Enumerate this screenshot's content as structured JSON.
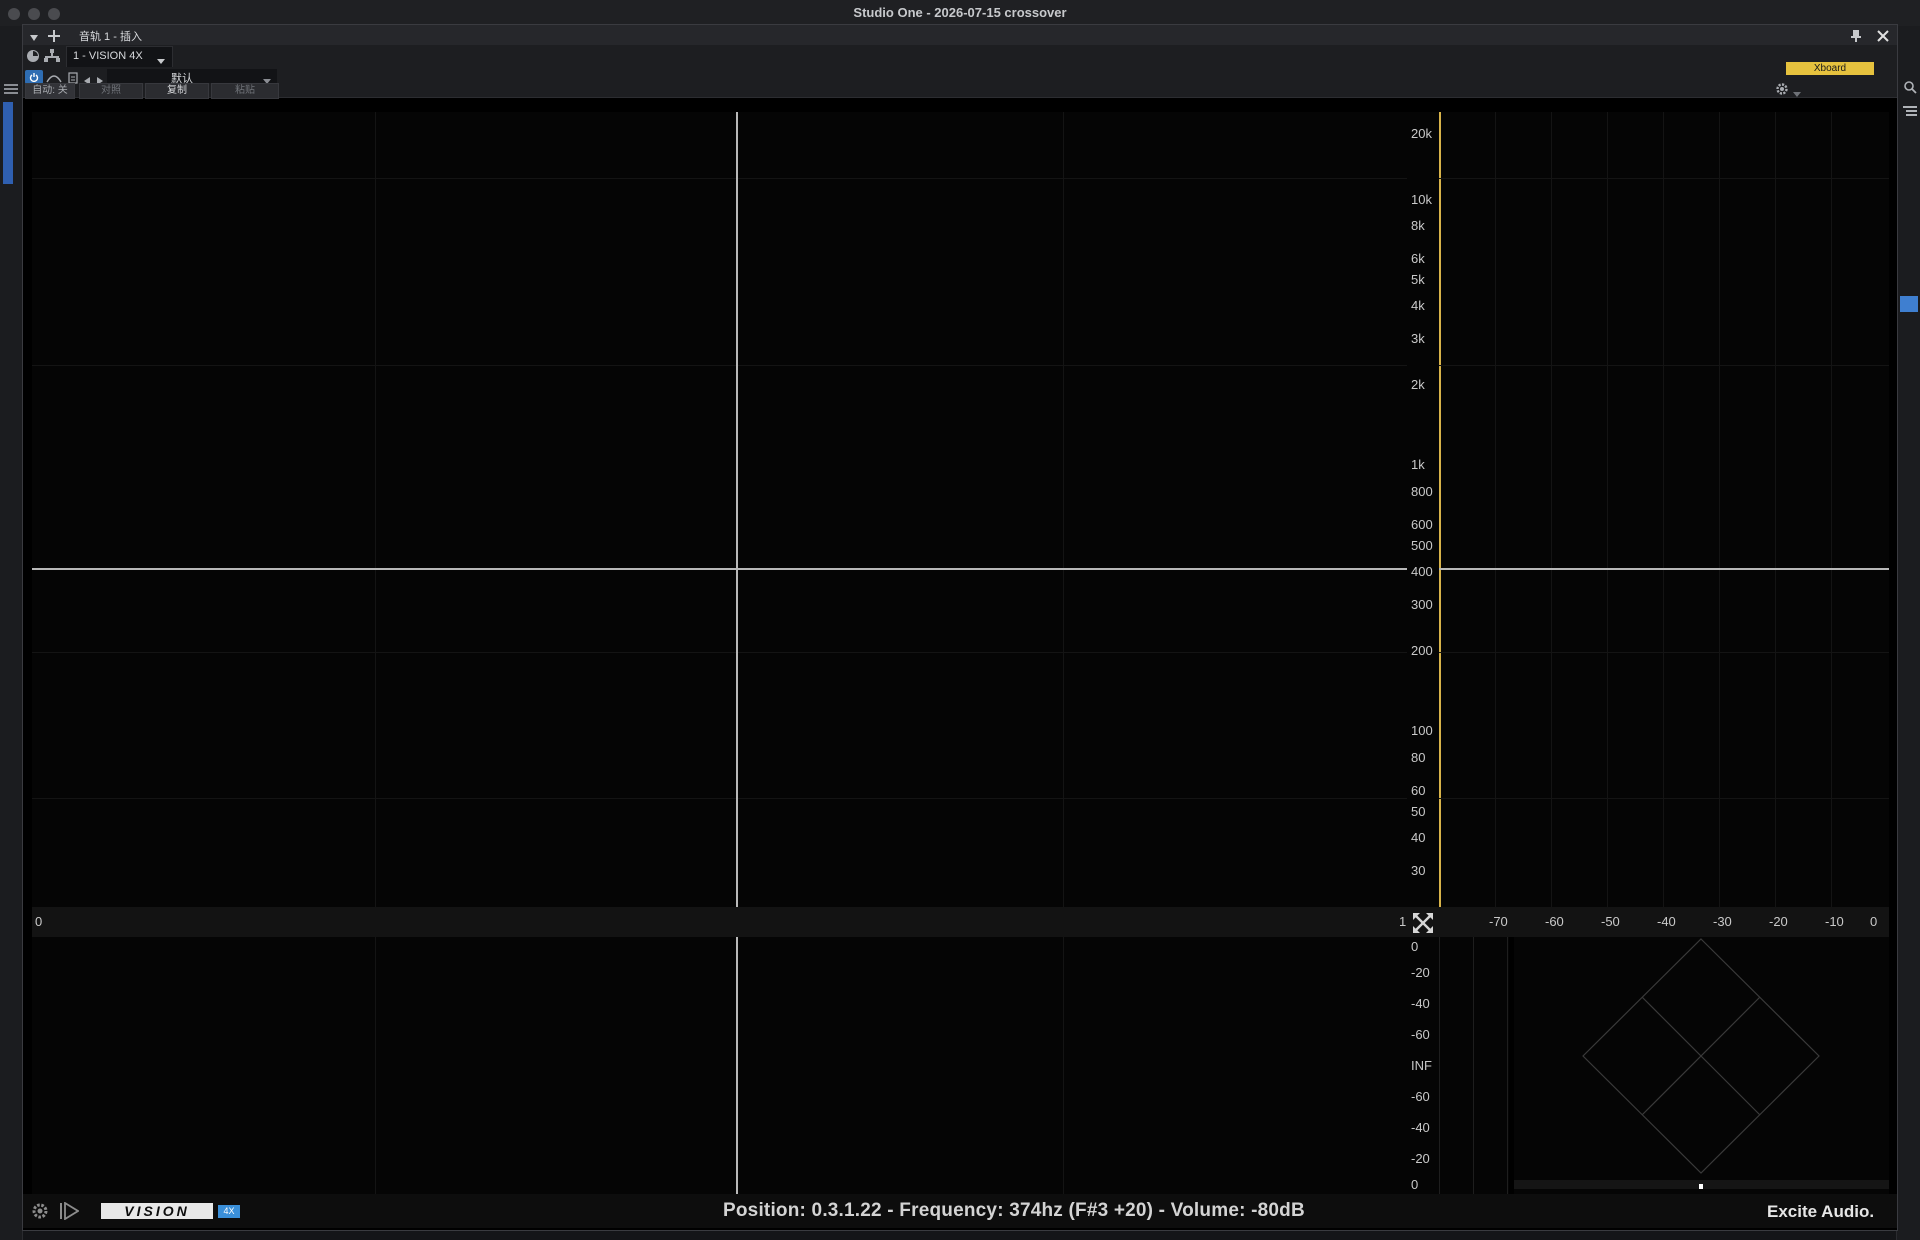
{
  "window": {
    "title": "Studio One - 2026-07-15 crossover"
  },
  "plugin_header": {
    "menu_icon": "triangle-down-icon",
    "add_icon": "plus-icon",
    "track_label": "音轨 1 - 插入",
    "pin_icon": "pin-icon",
    "close_icon": "close-icon"
  },
  "plugin_row2": {
    "slot_name": "1 - VISION 4X"
  },
  "plugin_row3": {
    "preset_name": "默认",
    "auto_label": "自动: 关",
    "compare_label": "对照",
    "copy_label": "复制",
    "paste_label": "粘贴",
    "xboard_label": "Xboard"
  },
  "freq_axis": [
    "20k",
    "10k",
    "8k",
    "6k",
    "5k",
    "4k",
    "3k",
    "2k",
    "1k",
    "800",
    "600",
    "500",
    "400",
    "300",
    "200",
    "100",
    "80",
    "60",
    "50",
    "40",
    "30"
  ],
  "time_axis": {
    "start": "0",
    "end": "1"
  },
  "db_axis": [
    "-70",
    "-60",
    "-50",
    "-40",
    "-30",
    "-20",
    "-10",
    "0"
  ],
  "level_axis": [
    "0",
    "-20",
    "-40",
    "-60",
    "INF",
    "-60",
    "-40",
    "-20",
    "0"
  ],
  "status": {
    "readout": "Position: 0.3.1.22 - Frequency: 374hz (F#3 +20) - Volume: -80dB"
  },
  "branding": {
    "logo_text": "VISION",
    "logo_badge": "4X",
    "company": "Excite Audio."
  },
  "colors": {
    "accent_yellow": "#e6c23e",
    "accent_blue": "#2e6db3",
    "crosshair": "#b9b9b9",
    "badge_blue": "#3a8fd9"
  }
}
